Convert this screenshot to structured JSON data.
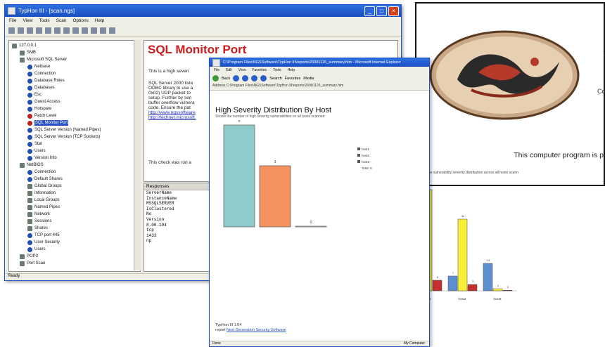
{
  "app": {
    "title": "TypHon III - [scan.ngs]",
    "menus": [
      "File",
      "View",
      "Tools",
      "Scan",
      "Options",
      "Help"
    ],
    "tree": [
      {
        "label": "127.0.0.1",
        "indent": 0,
        "icon": "fold"
      },
      {
        "label": "SMB",
        "indent": 1,
        "icon": "fold"
      },
      {
        "label": "Microsoft SQL Server",
        "indent": 1,
        "icon": "fold"
      },
      {
        "label": "Netbase",
        "indent": 2,
        "icon": "blue"
      },
      {
        "label": "Connection",
        "indent": 2,
        "icon": "blue"
      },
      {
        "label": "Database Roles",
        "indent": 2,
        "icon": "blue"
      },
      {
        "label": "Databases",
        "indent": 2,
        "icon": "blue"
      },
      {
        "label": "Esc",
        "indent": 2,
        "icon": "blue"
      },
      {
        "label": "Guest Access",
        "indent": 2,
        "icon": "blue"
      },
      {
        "label": "Hotspare",
        "indent": 2,
        "icon": "blue"
      },
      {
        "label": "Patch Level",
        "indent": 2,
        "icon": "red"
      },
      {
        "label": "SQL Monitor Port",
        "indent": 2,
        "icon": "red",
        "selected": true
      },
      {
        "label": "SQL Server Version (Named Pipes)",
        "indent": 2,
        "icon": "blue"
      },
      {
        "label": "SQL Server Version (TCP Sockets)",
        "indent": 2,
        "icon": "blue"
      },
      {
        "label": "Stat",
        "indent": 2,
        "icon": "blue"
      },
      {
        "label": "Users",
        "indent": 2,
        "icon": "blue"
      },
      {
        "label": "Version Info",
        "indent": 2,
        "icon": "blue"
      },
      {
        "label": "NetBIOS",
        "indent": 1,
        "icon": "fold"
      },
      {
        "label": "Connection",
        "indent": 2,
        "icon": "blue"
      },
      {
        "label": "Default Shares",
        "indent": 2,
        "icon": "blue"
      },
      {
        "label": "Global Groups",
        "indent": 2,
        "icon": "fold"
      },
      {
        "label": "Information",
        "indent": 2,
        "icon": "fold"
      },
      {
        "label": "Local Groups",
        "indent": 2,
        "icon": "fold"
      },
      {
        "label": "Named Pipes",
        "indent": 2,
        "icon": "fold"
      },
      {
        "label": "Network",
        "indent": 2,
        "icon": "fold"
      },
      {
        "label": "Sessions",
        "indent": 2,
        "icon": "fold"
      },
      {
        "label": "Shares",
        "indent": 2,
        "icon": "fold"
      },
      {
        "label": "TCP port 445",
        "indent": 2,
        "icon": "blue"
      },
      {
        "label": "User Security",
        "indent": 2,
        "icon": "blue"
      },
      {
        "label": "Users",
        "indent": 2,
        "icon": "blue"
      },
      {
        "label": "POP3",
        "indent": 1,
        "icon": "fold"
      },
      {
        "label": "Port Scan",
        "indent": 1,
        "icon": "fold"
      }
    ],
    "content": {
      "heading": "SQL Monitor Port",
      "intro": "This is a high severi",
      "p1": "SQL Server 2000 liste",
      "p2": "ODBC library to use a",
      "p3": "0x02) UDP packet to",
      "p4": "setup.  Further by sen",
      "p5": "buffer overflow vulnera",
      "p6": "code.  Ensure the pat",
      "link1": "http://www.ngssoftware",
      "link2": "http://technet.microsoft.",
      "check": "This check was run a"
    },
    "responses": {
      "header": "Responses",
      "lines": [
        "ServerName",
        "InstanceName",
        "MSSQLSERVER",
        "IsClustered",
        "No",
        "Version",
        "8.00.194",
        "tcp",
        "1433",
        "np"
      ]
    },
    "status": "Ready"
  },
  "report": {
    "title_bar": "C:\\Program Files\\NGSSoftware\\TypHon III\\reports\\20081126_summary.htm - Microsoft Internet Explorer",
    "menus": [
      "File",
      "Edit",
      "View",
      "Favorites",
      "Tools",
      "Help"
    ],
    "back_label": "Back",
    "search_label": "Search",
    "favorites_label": "Favorites",
    "media_label": "Media",
    "address_label": "Address",
    "address": "C:\\Program Files\\NGSSoftware\\TypHon III\\reports\\20081126_summary.htm",
    "heading": "High Severity Distribution By Host",
    "subheading": "Shows the number of high severity vulnerabilities on all hosts scanned",
    "footer_version": "TypHon III 1.04",
    "footer_by": "report",
    "footer_link": "Next Generation Security Software",
    "status_left": "Done",
    "status_right": "My Computer"
  },
  "splash": {
    "line_bottom": "This computer program is p",
    "line_mid": "Co",
    "line_top": "T"
  },
  "chart_data": [
    {
      "type": "bar",
      "title": "High Severity Distribution By Host",
      "categories": [
        "host1",
        "host2",
        "host3"
      ],
      "values": [
        5,
        3,
        0
      ],
      "value_labels": [
        "5",
        "3",
        "0"
      ],
      "legend": [
        "host1",
        "host2",
        "host3",
        "Total: 8"
      ],
      "colors": [
        "#8fcbcb",
        "#f5905f",
        "#6a6a6a"
      ]
    },
    {
      "type": "bar",
      "title": "V",
      "subtitle": "Shows the vulnerability severity distribution across all hosts scann",
      "categories": [
        "host1",
        "host2",
        "host3"
      ],
      "series": [
        {
          "values": [
            10,
            7,
            13
          ],
          "color": "#5b8fd0"
        },
        {
          "values": [
            48,
            34,
            1
          ],
          "color": "#f7ef38"
        },
        {
          "values": [
            5,
            3,
            0
          ],
          "color": "#c43030"
        }
      ],
      "ylim": [
        0,
        50
      ]
    }
  ],
  "colors": {
    "title_blue": "#1a4fc0",
    "heading_red": "#cc1b1b",
    "link": "#2233bb"
  }
}
